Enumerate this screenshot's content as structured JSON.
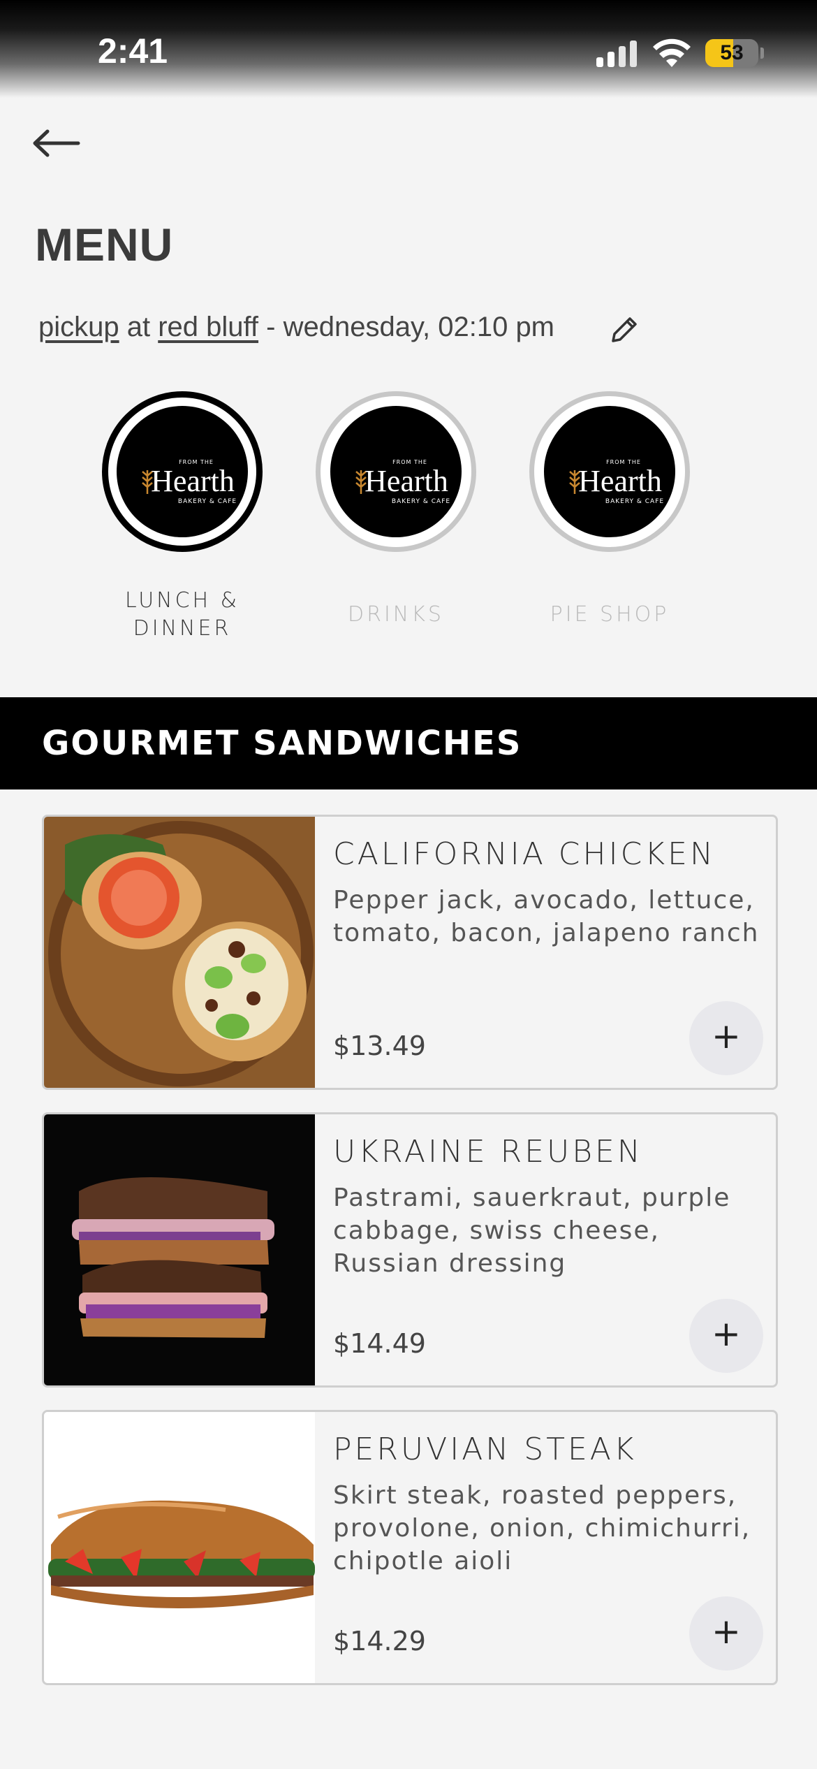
{
  "status_bar": {
    "time": "2:41",
    "battery": "53",
    "battery_level": 0.53
  },
  "header": {
    "title": "MENU"
  },
  "order_info": {
    "mode": "pickup",
    "connector": "at",
    "location": "red bluff",
    "datetime": "- wednesday, 02:10 pm"
  },
  "brand_logo": {
    "small_top": "FROM THE",
    "word": "Hearth",
    "small_bottom": "BAKERY & CAFE"
  },
  "categories": [
    {
      "label_line1": "LUNCH &",
      "label_line2": "DINNER",
      "active": true
    },
    {
      "label_line1": "DRINKS",
      "label_line2": "",
      "active": false
    },
    {
      "label_line1": "PIE SHOP",
      "label_line2": "",
      "active": false
    }
  ],
  "section": {
    "title": "GOURMET SANDWICHES"
  },
  "items": [
    {
      "name": "CALIFORNIA CHICKEN",
      "description": "Pepper jack, avocado, lettuce, tomato, bacon, jalapeno ranch",
      "price": "$13.49",
      "add_label": "+"
    },
    {
      "name": "UKRAINE REUBEN",
      "description": "Pastrami, sauerkraut, purple cabbage, swiss cheese, Russian dressing",
      "price": "$14.49",
      "add_label": "+"
    },
    {
      "name": "PERUVIAN STEAK",
      "description": "Skirt steak, roasted peppers, provolone, onion, chimichurri, chipotle aioli",
      "price": "$14.29",
      "add_label": "+"
    }
  ],
  "colors": {
    "accent": "#000000",
    "background": "#f4f4f4",
    "battery": "#f5c518"
  }
}
